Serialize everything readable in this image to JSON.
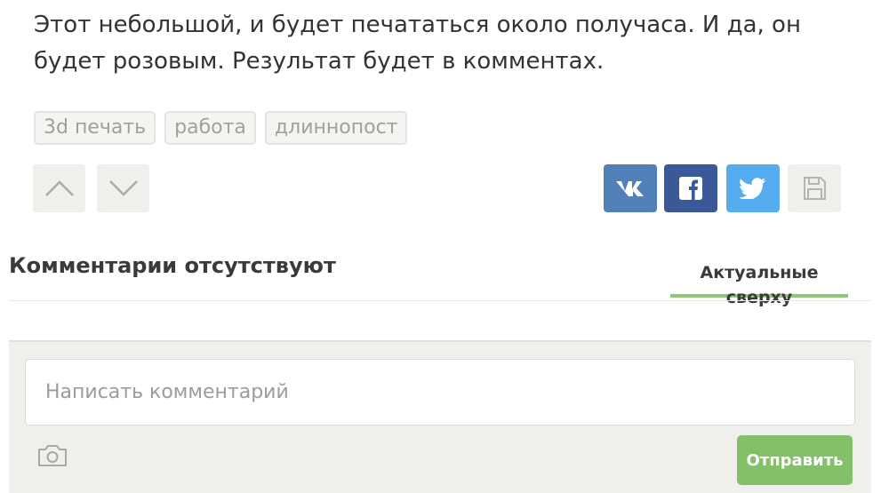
{
  "post": {
    "text": "Этот небольшой, и будет печататься около получаса. И да, он будет розовым. Результат будет в комментах.",
    "tags": [
      "3d печать",
      "работа",
      "длиннопост"
    ]
  },
  "icons": {
    "vote_up": "chevron-up-icon",
    "vote_down": "chevron-down-icon",
    "share": [
      "vk-icon",
      "facebook-icon",
      "twitter-icon",
      "save-icon"
    ],
    "attach": "camera-icon"
  },
  "colors": {
    "vk": "#5181b8",
    "facebook": "#3b5998",
    "twitter": "#55acee",
    "accent_green": "#82c06a"
  },
  "comments": {
    "title": "Комментарии отсутствуют",
    "sort_label": "Актуальные сверху",
    "input_placeholder": "Написать комментарий",
    "send_label": "Отправить"
  }
}
